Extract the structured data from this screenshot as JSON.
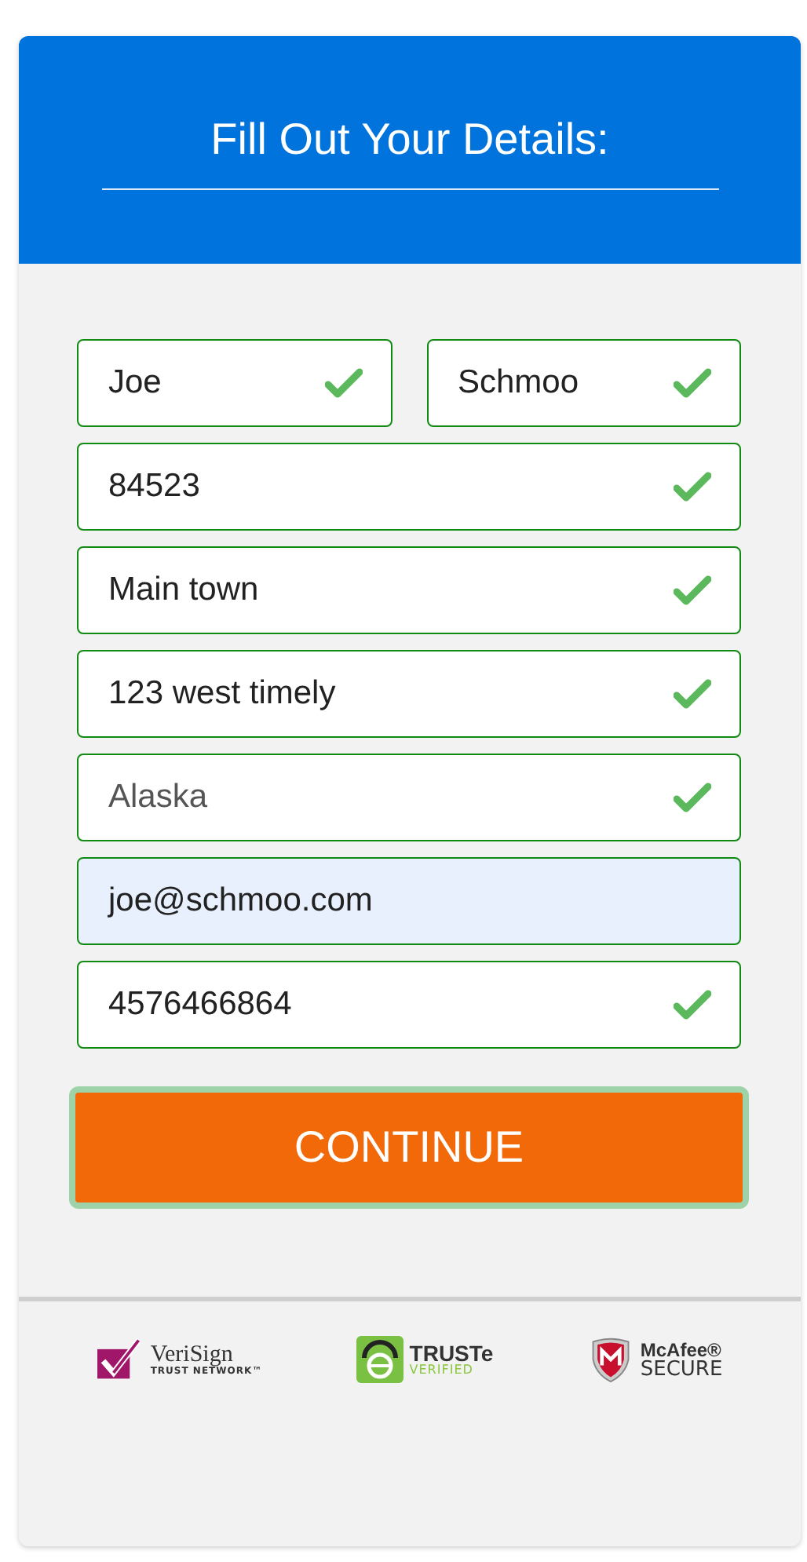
{
  "header": {
    "title": "Fill Out Your Details:"
  },
  "form": {
    "rows": [
      {
        "fields": [
          {
            "kind": "text",
            "value": "Joe",
            "valid": true,
            "autofilled": false
          },
          {
            "kind": "text",
            "value": "Schmoo",
            "valid": true,
            "autofilled": false
          }
        ]
      },
      {
        "fields": [
          {
            "kind": "text",
            "value": "84523",
            "valid": true,
            "autofilled": false
          }
        ]
      },
      {
        "fields": [
          {
            "kind": "text",
            "value": "Main town",
            "valid": true,
            "autofilled": false
          }
        ]
      },
      {
        "fields": [
          {
            "kind": "text",
            "value": "123 west timely",
            "valid": true,
            "autofilled": false
          }
        ]
      },
      {
        "fields": [
          {
            "kind": "select",
            "value": "Alaska",
            "valid": true,
            "autofilled": false
          }
        ]
      },
      {
        "fields": [
          {
            "kind": "text",
            "value": "joe@schmoo.com",
            "valid": false,
            "autofilled": true
          }
        ]
      },
      {
        "fields": [
          {
            "kind": "text",
            "value": "4576466864",
            "valid": true,
            "autofilled": false
          }
        ]
      }
    ],
    "submit": {
      "label": "CONTINUE",
      "focused": true
    }
  },
  "badges": [
    {
      "kind": "verisign",
      "name": "VeriSign",
      "tagline": "TRUST NETWORK™"
    },
    {
      "kind": "truste",
      "name": "TRUSTe",
      "tagline": "VERIFIED"
    },
    {
      "kind": "mcafee",
      "name": "McAfee®",
      "tagline": "SECURE"
    }
  ]
}
